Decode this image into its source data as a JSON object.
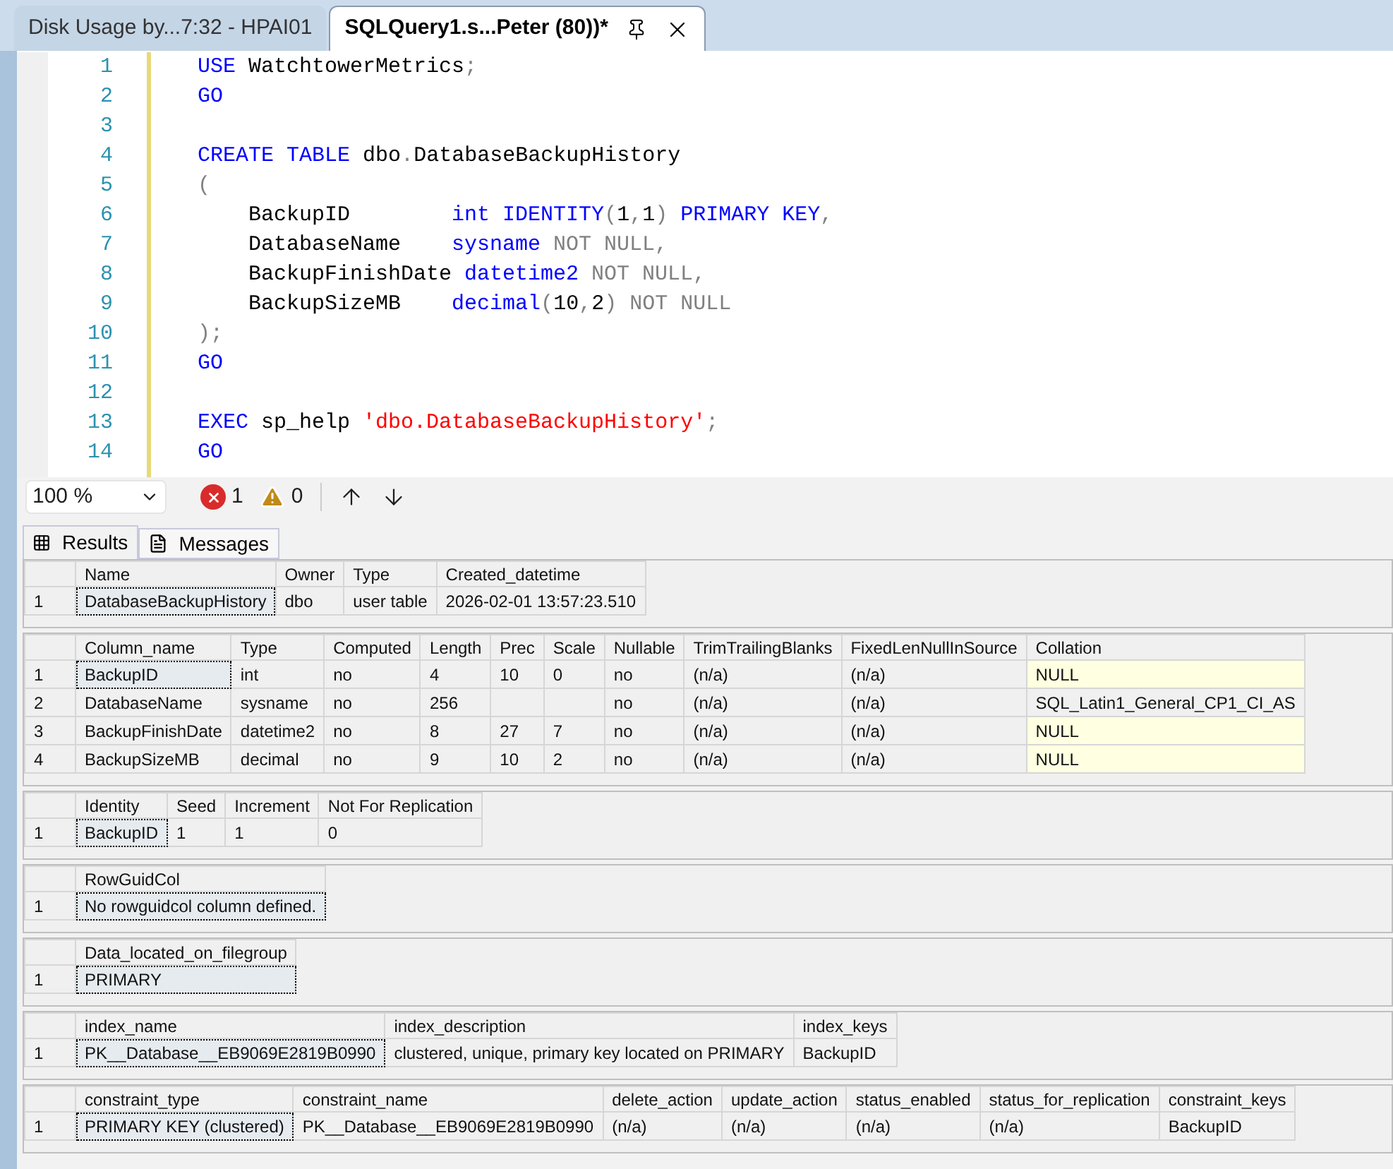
{
  "document_tabs": [
    {
      "label": "Disk Usage by...7:32 - HPAI01",
      "selected": false
    },
    {
      "label": "SQLQuery1.s...Peter (80))*",
      "selected": true
    }
  ],
  "editor": {
    "lines": [
      {
        "number": "1",
        "tokens": [
          {
            "kind": "keyword",
            "text": "USE"
          },
          {
            "kind": "plain",
            "text": " WatchtowerMetrics"
          },
          {
            "kind": "operator",
            "text": ";"
          }
        ]
      },
      {
        "number": "2",
        "tokens": [
          {
            "kind": "keyword",
            "text": "GO"
          }
        ]
      },
      {
        "number": "3"
      },
      {
        "number": "4",
        "tokens": [
          {
            "kind": "keyword",
            "text": "CREATE TABLE"
          },
          {
            "kind": "plain",
            "text": " dbo"
          },
          {
            "kind": "operator",
            "text": "."
          },
          {
            "kind": "plain",
            "text": "DatabaseBackupHistory"
          }
        ]
      },
      {
        "number": "5",
        "tokens": [
          {
            "kind": "operator",
            "text": "("
          }
        ]
      },
      {
        "number": "6",
        "tokens": [
          {
            "kind": "plain",
            "text": "    BackupID        "
          },
          {
            "kind": "keyword",
            "text": "int IDENTITY"
          },
          {
            "kind": "operator",
            "text": "("
          },
          {
            "kind": "plain",
            "text": "1"
          },
          {
            "kind": "operator",
            "text": ","
          },
          {
            "kind": "plain",
            "text": "1"
          },
          {
            "kind": "operator",
            "text": ")"
          },
          {
            "kind": "keyword",
            "text": " PRIMARY KEY"
          },
          {
            "kind": "operator",
            "text": ","
          }
        ]
      },
      {
        "number": "7",
        "tokens": [
          {
            "kind": "plain",
            "text": "    DatabaseName    "
          },
          {
            "kind": "keyword",
            "text": "sysname"
          },
          {
            "kind": "operator",
            "text": " NOT NULL,"
          }
        ]
      },
      {
        "number": "8",
        "tokens": [
          {
            "kind": "plain",
            "text": "    BackupFinishDate "
          },
          {
            "kind": "keyword",
            "text": "datetime2"
          },
          {
            "kind": "operator",
            "text": " NOT NULL,"
          }
        ]
      },
      {
        "number": "9",
        "tokens": [
          {
            "kind": "plain",
            "text": "    BackupSizeMB    "
          },
          {
            "kind": "keyword",
            "text": "decimal"
          },
          {
            "kind": "operator",
            "text": "("
          },
          {
            "kind": "plain",
            "text": "10"
          },
          {
            "kind": "operator",
            "text": ","
          },
          {
            "kind": "plain",
            "text": "2"
          },
          {
            "kind": "operator",
            "text": ") NOT NULL"
          }
        ]
      },
      {
        "number": "10",
        "tokens": [
          {
            "kind": "operator",
            "text": ");"
          }
        ]
      },
      {
        "number": "11",
        "tokens": [
          {
            "kind": "keyword",
            "text": "GO"
          }
        ]
      },
      {
        "number": "12"
      },
      {
        "number": "13",
        "tokens": [
          {
            "kind": "keyword",
            "text": "EXEC"
          },
          {
            "kind": "plain",
            "text": " sp_help "
          },
          {
            "kind": "string",
            "text": "'dbo.DatabaseBackupHistory'"
          },
          {
            "kind": "operator",
            "text": ";"
          }
        ]
      },
      {
        "number": "14",
        "tokens": [
          {
            "kind": "keyword",
            "text": "GO"
          }
        ]
      }
    ]
  },
  "status_toolbar": {
    "zoom": "100 %",
    "errors": "1",
    "warnings": "0"
  },
  "result_tabs": [
    {
      "label": "Results",
      "selected": true
    },
    {
      "label": "Messages",
      "selected": false
    }
  ],
  "grids": [
    {
      "columns": [
        "Name",
        "Owner",
        "Type",
        "Created_datetime"
      ],
      "rows": [
        {
          "number": "1",
          "cells": [
            {
              "text": "DatabaseBackupHistory",
              "focused": true
            },
            "dbo",
            "user table",
            "2026-02-01 13:57:23.510"
          ]
        }
      ]
    },
    {
      "columns": [
        "Column_name",
        "Type",
        "Computed",
        "Length",
        "Prec",
        "Scale",
        "Nullable",
        "TrimTrailingBlanks",
        "FixedLenNullInSource",
        "Collation"
      ],
      "rows": [
        {
          "number": "1",
          "cells": [
            {
              "text": "BackupID",
              "focused": true
            },
            "int",
            "no",
            "4",
            "10",
            "0",
            "no",
            "(n/a)",
            "(n/a)",
            {
              "text": "NULL",
              "is_null": true
            }
          ]
        },
        {
          "number": "2",
          "cells": [
            "DatabaseName",
            "sysname",
            "no",
            "256",
            "",
            "",
            "no",
            "(n/a)",
            "(n/a)",
            "SQL_Latin1_General_CP1_CI_AS"
          ]
        },
        {
          "number": "3",
          "cells": [
            "BackupFinishDate",
            "datetime2",
            "no",
            "8",
            "27",
            "7",
            "no",
            "(n/a)",
            "(n/a)",
            {
              "text": "NULL",
              "is_null": true
            }
          ]
        },
        {
          "number": "4",
          "cells": [
            "BackupSizeMB",
            "decimal",
            "no",
            "9",
            "10",
            "2",
            "no",
            "(n/a)",
            "(n/a)",
            {
              "text": "NULL",
              "is_null": true
            }
          ]
        }
      ]
    },
    {
      "columns": [
        "Identity",
        "Seed",
        "Increment",
        "Not For Replication"
      ],
      "rows": [
        {
          "number": "1",
          "cells": [
            {
              "text": "BackupID",
              "focused": true
            },
            "1",
            "1",
            "0"
          ]
        }
      ]
    },
    {
      "columns": [
        "RowGuidCol"
      ],
      "rows": [
        {
          "number": "1",
          "cells": [
            {
              "text": "No rowguidcol column defined.",
              "focused": true
            }
          ]
        }
      ]
    },
    {
      "columns": [
        "Data_located_on_filegroup"
      ],
      "rows": [
        {
          "number": "1",
          "cells": [
            {
              "text": "PRIMARY",
              "focused": true
            }
          ]
        }
      ]
    },
    {
      "columns": [
        "index_name",
        "index_description",
        "index_keys"
      ],
      "rows": [
        {
          "number": "1",
          "cells": [
            {
              "text": "PK__Database__EB9069E2819B0990",
              "focused": true
            },
            "clustered, unique, primary key located on PRIMARY",
            "BackupID"
          ]
        }
      ]
    },
    {
      "columns": [
        "constraint_type",
        "constraint_name",
        "delete_action",
        "update_action",
        "status_enabled",
        "status_for_replication",
        "constraint_keys"
      ],
      "rows": [
        {
          "number": "1",
          "cells": [
            {
              "text": "PRIMARY KEY (clustered)",
              "focused": true
            },
            "PK__Database__EB9069E2819B0990",
            "(n/a)",
            "(n/a)",
            "(n/a)",
            "(n/a)",
            "BackupID"
          ]
        }
      ]
    }
  ]
}
